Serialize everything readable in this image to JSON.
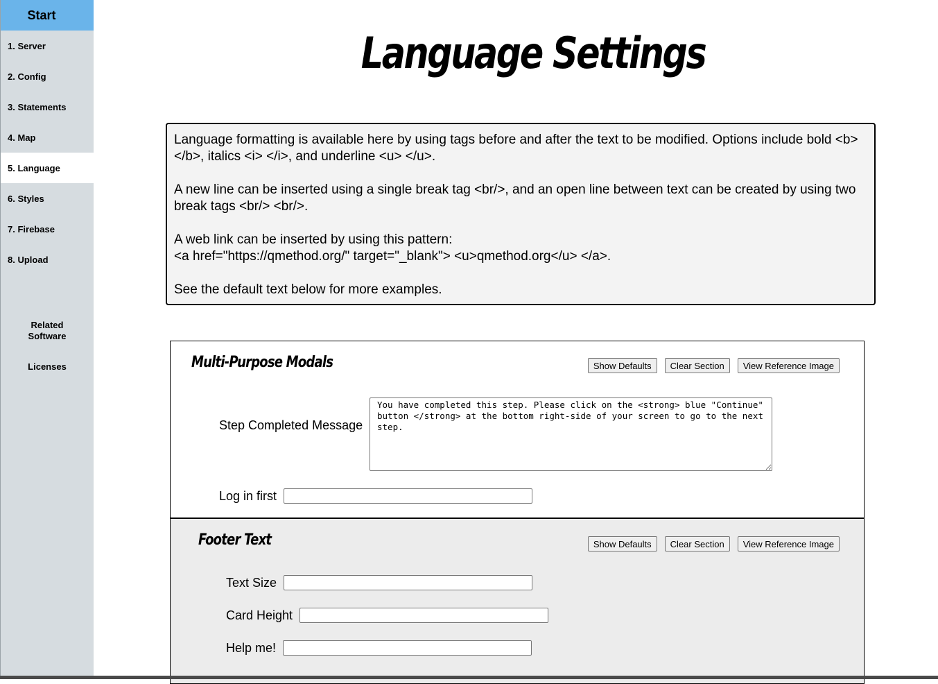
{
  "sidebar": {
    "start_label": "Start",
    "items": [
      {
        "label": "1. Server"
      },
      {
        "label": "2. Config"
      },
      {
        "label": "3. Statements"
      },
      {
        "label": "4. Map"
      },
      {
        "label": "5. Language",
        "active": true
      },
      {
        "label": "6. Styles"
      },
      {
        "label": "7. Firebase"
      },
      {
        "label": "8. Upload"
      }
    ],
    "related_software": "Related Software",
    "licenses": "Licenses"
  },
  "page": {
    "title": "Language Settings"
  },
  "info": {
    "p1": "Language formatting is available here by using tags before and after the text to be modified. Options include bold <b> </b>, italics <i> </i>, and underline <u> </u>.",
    "p2": "A new line can be inserted using a single break tag <br/>, and an open line between text can be created by using two break tags <br/> <br/>.",
    "p3_line1": "A web link can be inserted by using this pattern:",
    "p3_line2": "<a href=\"https://qmethod.org/\" target=\"_blank\"> <u>qmethod.org</u> </a>.",
    "p4": "See the default text below for more examples."
  },
  "buttons": {
    "show_defaults": "Show Defaults",
    "clear_section": "Clear Section",
    "view_reference": "View Reference Image"
  },
  "modals_section": {
    "title": "Multi-Purpose Modals",
    "step_completed_label": "Step Completed Message",
    "step_completed_value": "You have completed this step. Please click on the <strong> blue \"Continue\" button </strong> at the bottom right-side of your screen to go to the next step.",
    "log_in_first_label": "Log in first",
    "log_in_first_value": ""
  },
  "footer_section": {
    "title": "Footer Text",
    "text_size_label": "Text Size",
    "text_size_value": "",
    "card_height_label": "Card Height",
    "card_height_value": "",
    "help_me_label": "Help me!",
    "help_me_value": ""
  }
}
